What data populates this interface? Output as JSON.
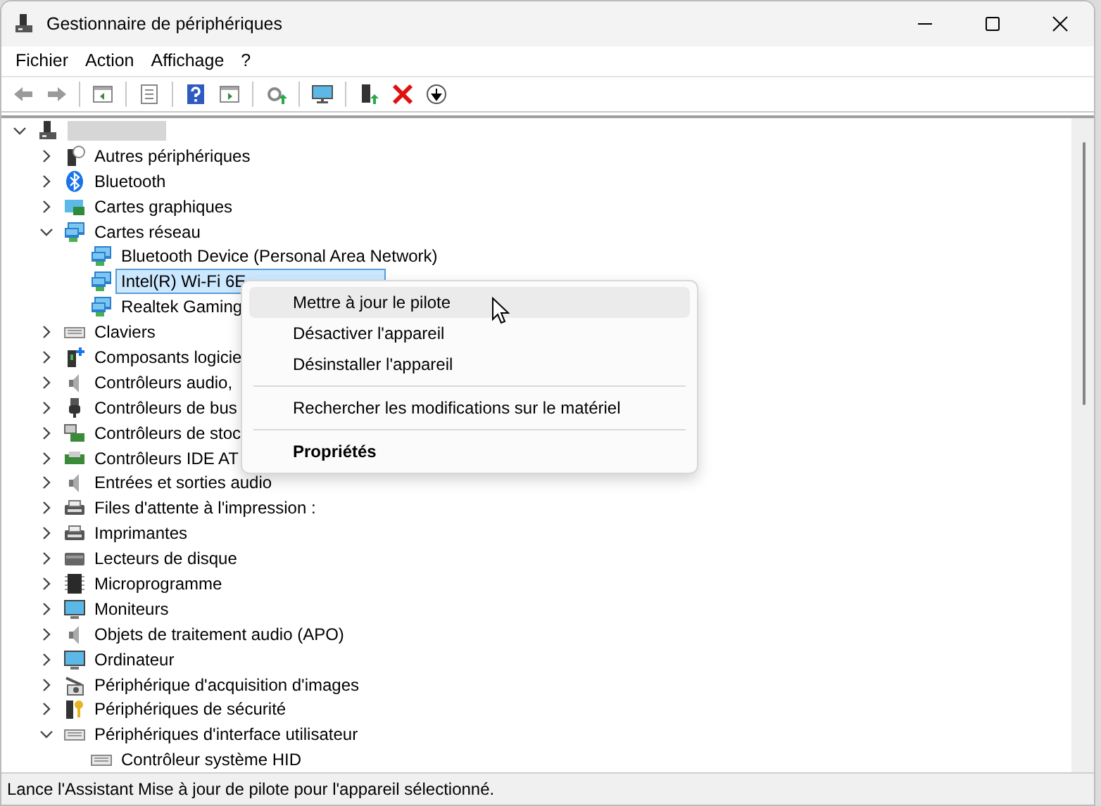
{
  "window": {
    "title": "Gestionnaire de périphériques"
  },
  "menu_bar": [
    "Fichier",
    "Action",
    "Affichage",
    "?"
  ],
  "tree": {
    "kind": "computer",
    "expanded": true,
    "children": [
      {
        "label": "Autres périphériques",
        "kind": "unknown",
        "expanded": false
      },
      {
        "label": "Bluetooth",
        "kind": "bluetooth",
        "expanded": false
      },
      {
        "label": "Cartes graphiques",
        "kind": "display",
        "expanded": false
      },
      {
        "label": "Cartes réseau",
        "kind": "network",
        "expanded": true,
        "children": [
          {
            "label": "Bluetooth Device (Personal Area Network)",
            "kind": "network",
            "selected": false
          },
          {
            "label": "Intel(R) Wi-Fi 6E",
            "kind": "network",
            "selected": true
          },
          {
            "label": "Realtek Gaming",
            "kind": "network",
            "selected": false
          }
        ]
      },
      {
        "label": "Claviers",
        "kind": "keyboard",
        "expanded": false
      },
      {
        "label": "Composants logicie",
        "kind": "software",
        "expanded": false
      },
      {
        "label": "Contrôleurs audio,",
        "kind": "audio",
        "expanded": false
      },
      {
        "label": "Contrôleurs de bus",
        "kind": "usb",
        "expanded": false
      },
      {
        "label": "Contrôleurs de stoc",
        "kind": "storage",
        "expanded": false
      },
      {
        "label": "Contrôleurs IDE AT",
        "kind": "board",
        "expanded": false
      },
      {
        "label": "Entrées et sorties audio",
        "kind": "audio",
        "expanded": false
      },
      {
        "label": "Files d'attente à l'impression :",
        "kind": "printer",
        "expanded": false
      },
      {
        "label": "Imprimantes",
        "kind": "printer",
        "expanded": false
      },
      {
        "label": "Lecteurs de disque",
        "kind": "disk",
        "expanded": false
      },
      {
        "label": "Microprogramme",
        "kind": "chip",
        "expanded": false
      },
      {
        "label": "Moniteurs",
        "kind": "monitor",
        "expanded": false
      },
      {
        "label": "Objets de traitement audio (APO)",
        "kind": "audio",
        "expanded": false
      },
      {
        "label": "Ordinateur",
        "kind": "monitor",
        "expanded": false
      },
      {
        "label": "Périphérique d'acquisition d'images",
        "kind": "camera",
        "expanded": false
      },
      {
        "label": "Périphériques de sécurité",
        "kind": "security",
        "expanded": false
      },
      {
        "label": "Périphériques d'interface utilisateur",
        "kind": "keyboard",
        "expanded": true,
        "children": [
          {
            "label": "Contrôleur système HID",
            "kind": "keyboard",
            "selected": false
          }
        ]
      }
    ]
  },
  "context_menu": [
    {
      "kind": "item",
      "label": "Mettre à jour le pilote",
      "highlighted": true,
      "default": false
    },
    {
      "kind": "item",
      "label": "Désactiver l'appareil",
      "highlighted": false,
      "default": false
    },
    {
      "kind": "item",
      "label": "Désinstaller l'appareil",
      "highlighted": false,
      "default": false
    },
    {
      "kind": "separator"
    },
    {
      "kind": "item",
      "label": "Rechercher les modifications sur le matériel",
      "highlighted": false,
      "default": false
    },
    {
      "kind": "separator"
    },
    {
      "kind": "item",
      "label": "Propriétés",
      "highlighted": false,
      "default": true
    }
  ],
  "status_bar": "Lance l'Assistant Mise à jour de pilote pour l'appareil sélectionné."
}
